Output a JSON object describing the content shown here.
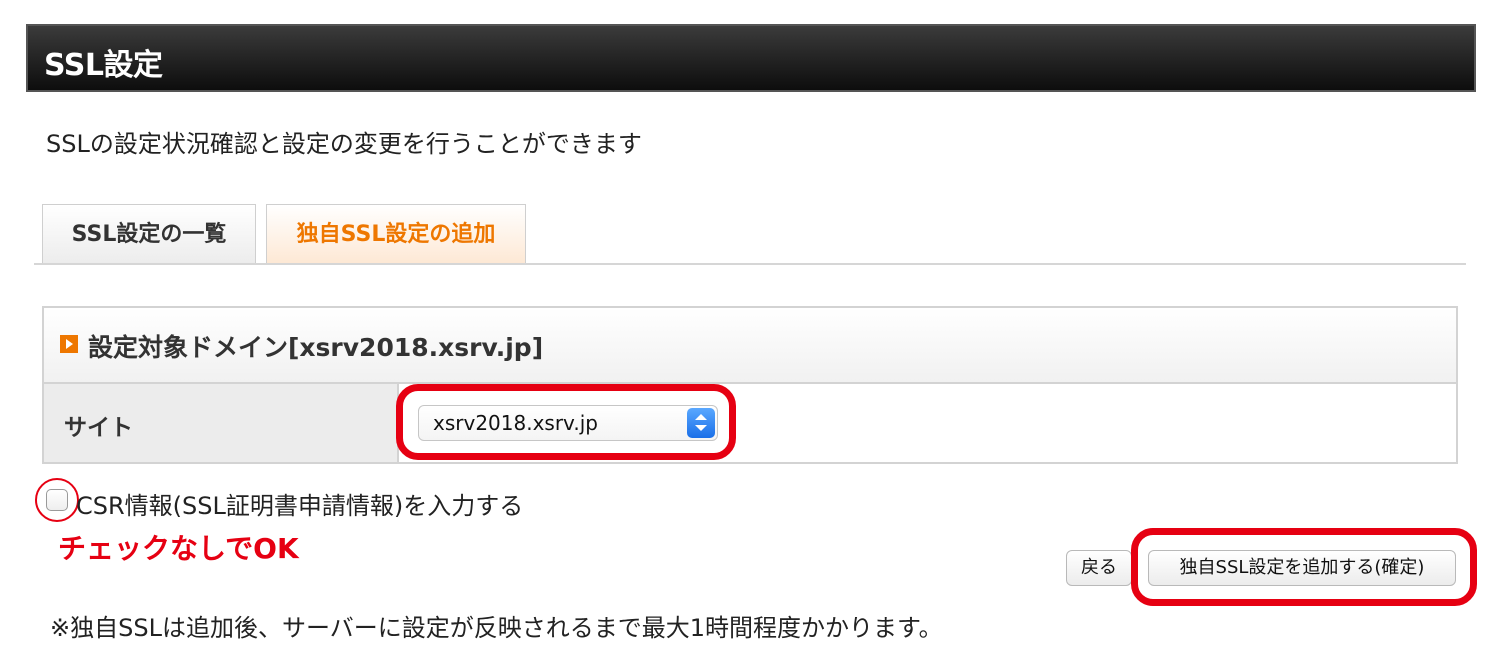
{
  "header": {
    "title": "SSL設定"
  },
  "description": "SSLの設定状況確認と設定の変更を行うことができます",
  "tabs": [
    {
      "label": "SSL設定の一覧",
      "active": false
    },
    {
      "label": "独自SSL設定の追加",
      "active": true
    }
  ],
  "domain_section": {
    "icon": "orange-arrow-icon",
    "title": "設定対象ドメイン[xsrv2018.xsrv.jp]",
    "site_label": "サイト",
    "site_select_value": "xsrv2018.xsrv.jp"
  },
  "csr": {
    "checked": false,
    "label": "CSR情報(SSL証明書申請情報)を入力する"
  },
  "annotation": "チェックなしでOK",
  "buttons": {
    "back_label": "戻る",
    "confirm_label": "独自SSL設定を追加する(確定)"
  },
  "note": "※独自SSLは追加後、サーバーに設定が反映されるまで最大1時間程度かかります。",
  "colors": {
    "header_bg": "#1a1a1a",
    "accent_orange": "#ee7700",
    "highlight_red": "#e60012"
  }
}
